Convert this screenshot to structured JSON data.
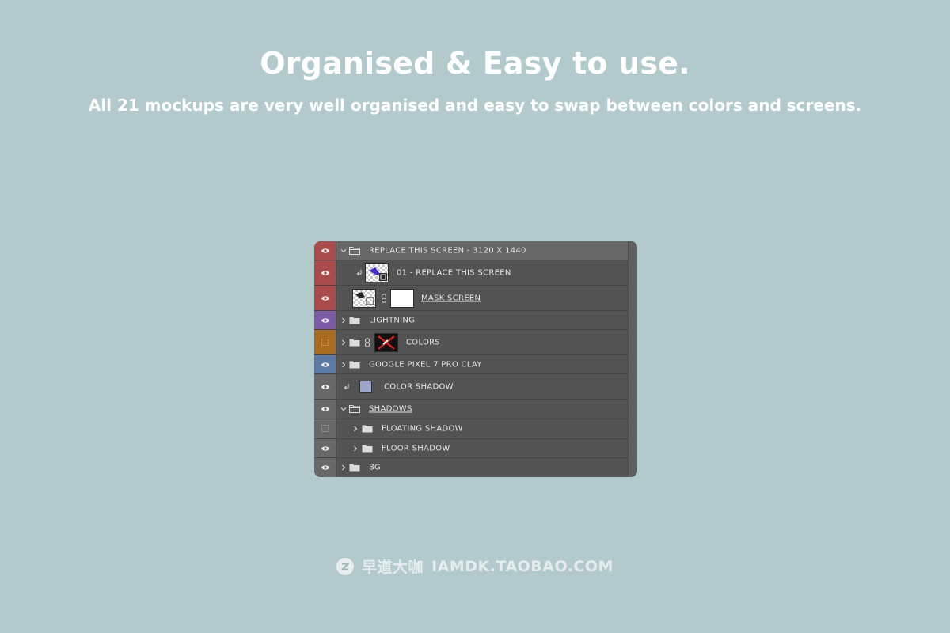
{
  "header": {
    "title": "Organised & Easy to use.",
    "subtitle": "All 21 mockups are very well organised and easy to swap between colors and screens."
  },
  "layers": [
    {
      "label": "REPLACE THIS SCREEN - 3120 X 1440",
      "visible": true,
      "tag_color": "#a94b4b",
      "expanded": true,
      "selected": true
    },
    {
      "label": "01 - REPLACE THIS SCREEN",
      "visible": true,
      "tag_color": "#a94b4b"
    },
    {
      "label": "MASK SCREEN",
      "visible": true,
      "tag_color": "#a94b4b",
      "underlined": true
    },
    {
      "label": "LIGHTNING",
      "visible": true,
      "tag_color": "#7b5ba7",
      "expanded": false
    },
    {
      "label": "COLORS",
      "visible": false,
      "tag_color": "#a86a1e",
      "expanded": false
    },
    {
      "label": "GOOGLE PIXEL 7 PRO CLAY",
      "visible": true,
      "tag_color": "#5b7aa6",
      "expanded": false
    },
    {
      "label": "COLOR SHADOW",
      "visible": true,
      "tag_color": "#686868",
      "swatch_color": "#9ba6c9"
    },
    {
      "label": "SHADOWS",
      "visible": true,
      "tag_color": "#686868",
      "expanded": true,
      "underlined": true
    },
    {
      "label": "FLOATING SHADOW",
      "visible": false,
      "tag_color": "#686868",
      "expanded": false
    },
    {
      "label": "FLOOR SHADOW",
      "visible": true,
      "tag_color": "#686868",
      "expanded": false
    },
    {
      "label": "BG",
      "visible": true,
      "tag_color": "#686868",
      "expanded": false
    }
  ],
  "footer": {
    "logo_icon": "z-circle-logo",
    "brand_text": "早道大咖",
    "url_text": "IAMDK.TAOBAO.COM"
  },
  "colors": {
    "background": "#b2cacb",
    "panel": "#535353",
    "selected_row": "#676767"
  }
}
